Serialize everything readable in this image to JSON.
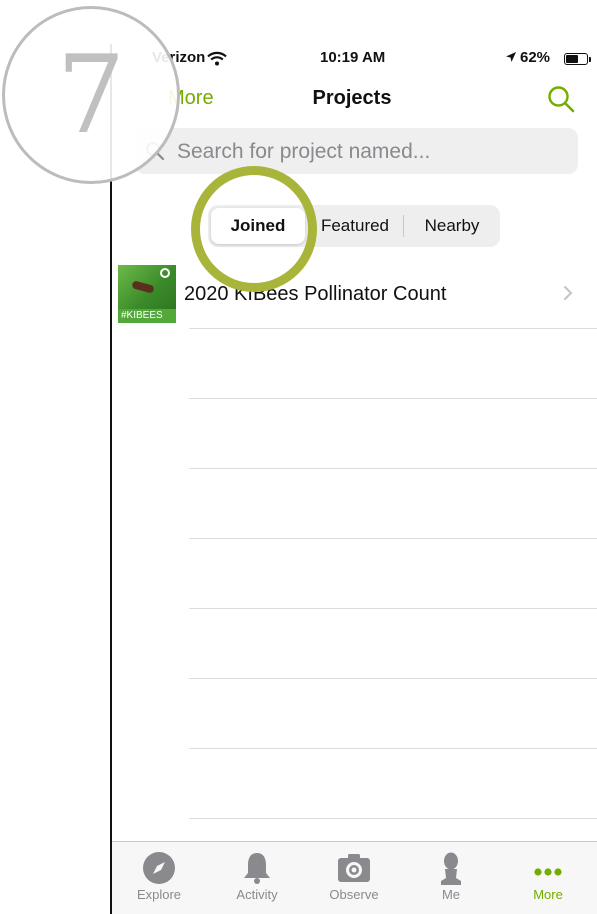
{
  "status_bar": {
    "carrier": "Verizon",
    "time": "10:19 AM",
    "battery": "62%",
    "battery_level": 0.62
  },
  "nav": {
    "back_label": "More",
    "title": "Projects",
    "search_icon": "search-icon"
  },
  "search": {
    "placeholder": "Search for project named...",
    "value": ""
  },
  "segments": {
    "items": [
      "Joined",
      "Featured",
      "Nearby"
    ],
    "selected": "Joined"
  },
  "projects": [
    {
      "thumbnail_text": "#KIBEES",
      "title": "2020 KIBees Pollinator Count"
    }
  ],
  "tabbar": {
    "items": [
      {
        "label": "Explore",
        "icon": "compass-icon"
      },
      {
        "label": "Activity",
        "icon": "bell-icon"
      },
      {
        "label": "Observe",
        "icon": "camera-icon"
      },
      {
        "label": "Me",
        "icon": "person-icon"
      },
      {
        "label": "More",
        "icon": "more-dots-icon"
      }
    ],
    "active": "More"
  },
  "step_badge": {
    "number": "7"
  },
  "colors": {
    "accent": "#74ac00",
    "highlight_ring": "#a9b53a",
    "badge_grey": "#c0c0c0"
  }
}
